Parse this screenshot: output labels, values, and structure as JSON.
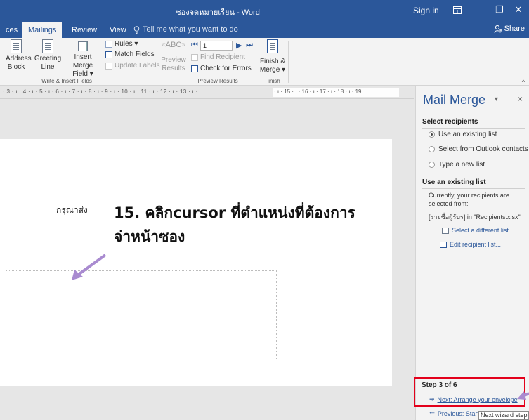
{
  "window": {
    "doc_title": "ซองจดหมายเรียน  -  Word",
    "sign_in": "Sign in",
    "ribbon_display_icon": "ribbon-display-icon",
    "minimize_glyph": "–",
    "restore_glyph": "❐",
    "close_glyph": "✕"
  },
  "tabs": {
    "items": [
      "ces",
      "Mailings",
      "Review",
      "View"
    ],
    "active": "Mailings",
    "tell_me": "Tell me what you want to do",
    "share": "Share"
  },
  "ribbon": {
    "write_insert": {
      "address_block_l1": "Address",
      "address_block_l2": "Block",
      "greeting_l1": "Greeting",
      "greeting_l2": "Line",
      "insert_merge_l1": "Insert Merge",
      "insert_merge_l2": "Field ▾",
      "rules": "Rules ▾",
      "match_fields": "Match Fields",
      "update_labels": "Update Labels",
      "group_label": "Write & Insert Fields"
    },
    "preview": {
      "preview_l1": "Preview",
      "preview_l2": "Results",
      "record": "1",
      "find_recipient": "Find Recipient",
      "check_errors": "Check for Errors",
      "group_label": "Preview Results"
    },
    "finish": {
      "finish_l1": "Finish &",
      "finish_l2": "Merge ▾",
      "group_label": "Finish"
    },
    "collapse_glyph": "^"
  },
  "ruler": {
    "left_text": "· 3 · ı · 4 · ı · 5 · ı · 6 · ı · 7 · ı · 8 · ı · 9 · ı · 10 · ı · 11 · ı · 12 · ı · 13 · ı ·",
    "right_text": "· ı · 15 · ı · 16 · ı · 17 · ı · 18 · ı · 19"
  },
  "document": {
    "small_label": "กรุณาส่ง",
    "annotation_line1": "15. คลิกcursor ที่ตำแหน่งที่ต้องการ",
    "annotation_line2": "จ่าหน้าซอง"
  },
  "mail_merge": {
    "title": "Mail Merge",
    "caret": "▾",
    "close": "×",
    "select_recipients": "Select recipients",
    "options": [
      "Use an existing list",
      "Select from Outlook contacts",
      "Type a new list"
    ],
    "selected_option": 0,
    "use_existing_heading": "Use an existing list",
    "current_text": "Currently, your recipients are selected from:",
    "source_text": "[รายชื่อผู้รับร] in \"Recipients.xlsx\"",
    "select_different": "Select a different list...",
    "edit_list": "Edit recipient list...",
    "step": "Step 3 of 6",
    "next_link": "Next: Arrange your envelope",
    "prev_link": "Previous: Starti",
    "tooltip": "Next wizard step",
    "accent": "#2b579a",
    "highlight": "#e3001b"
  }
}
